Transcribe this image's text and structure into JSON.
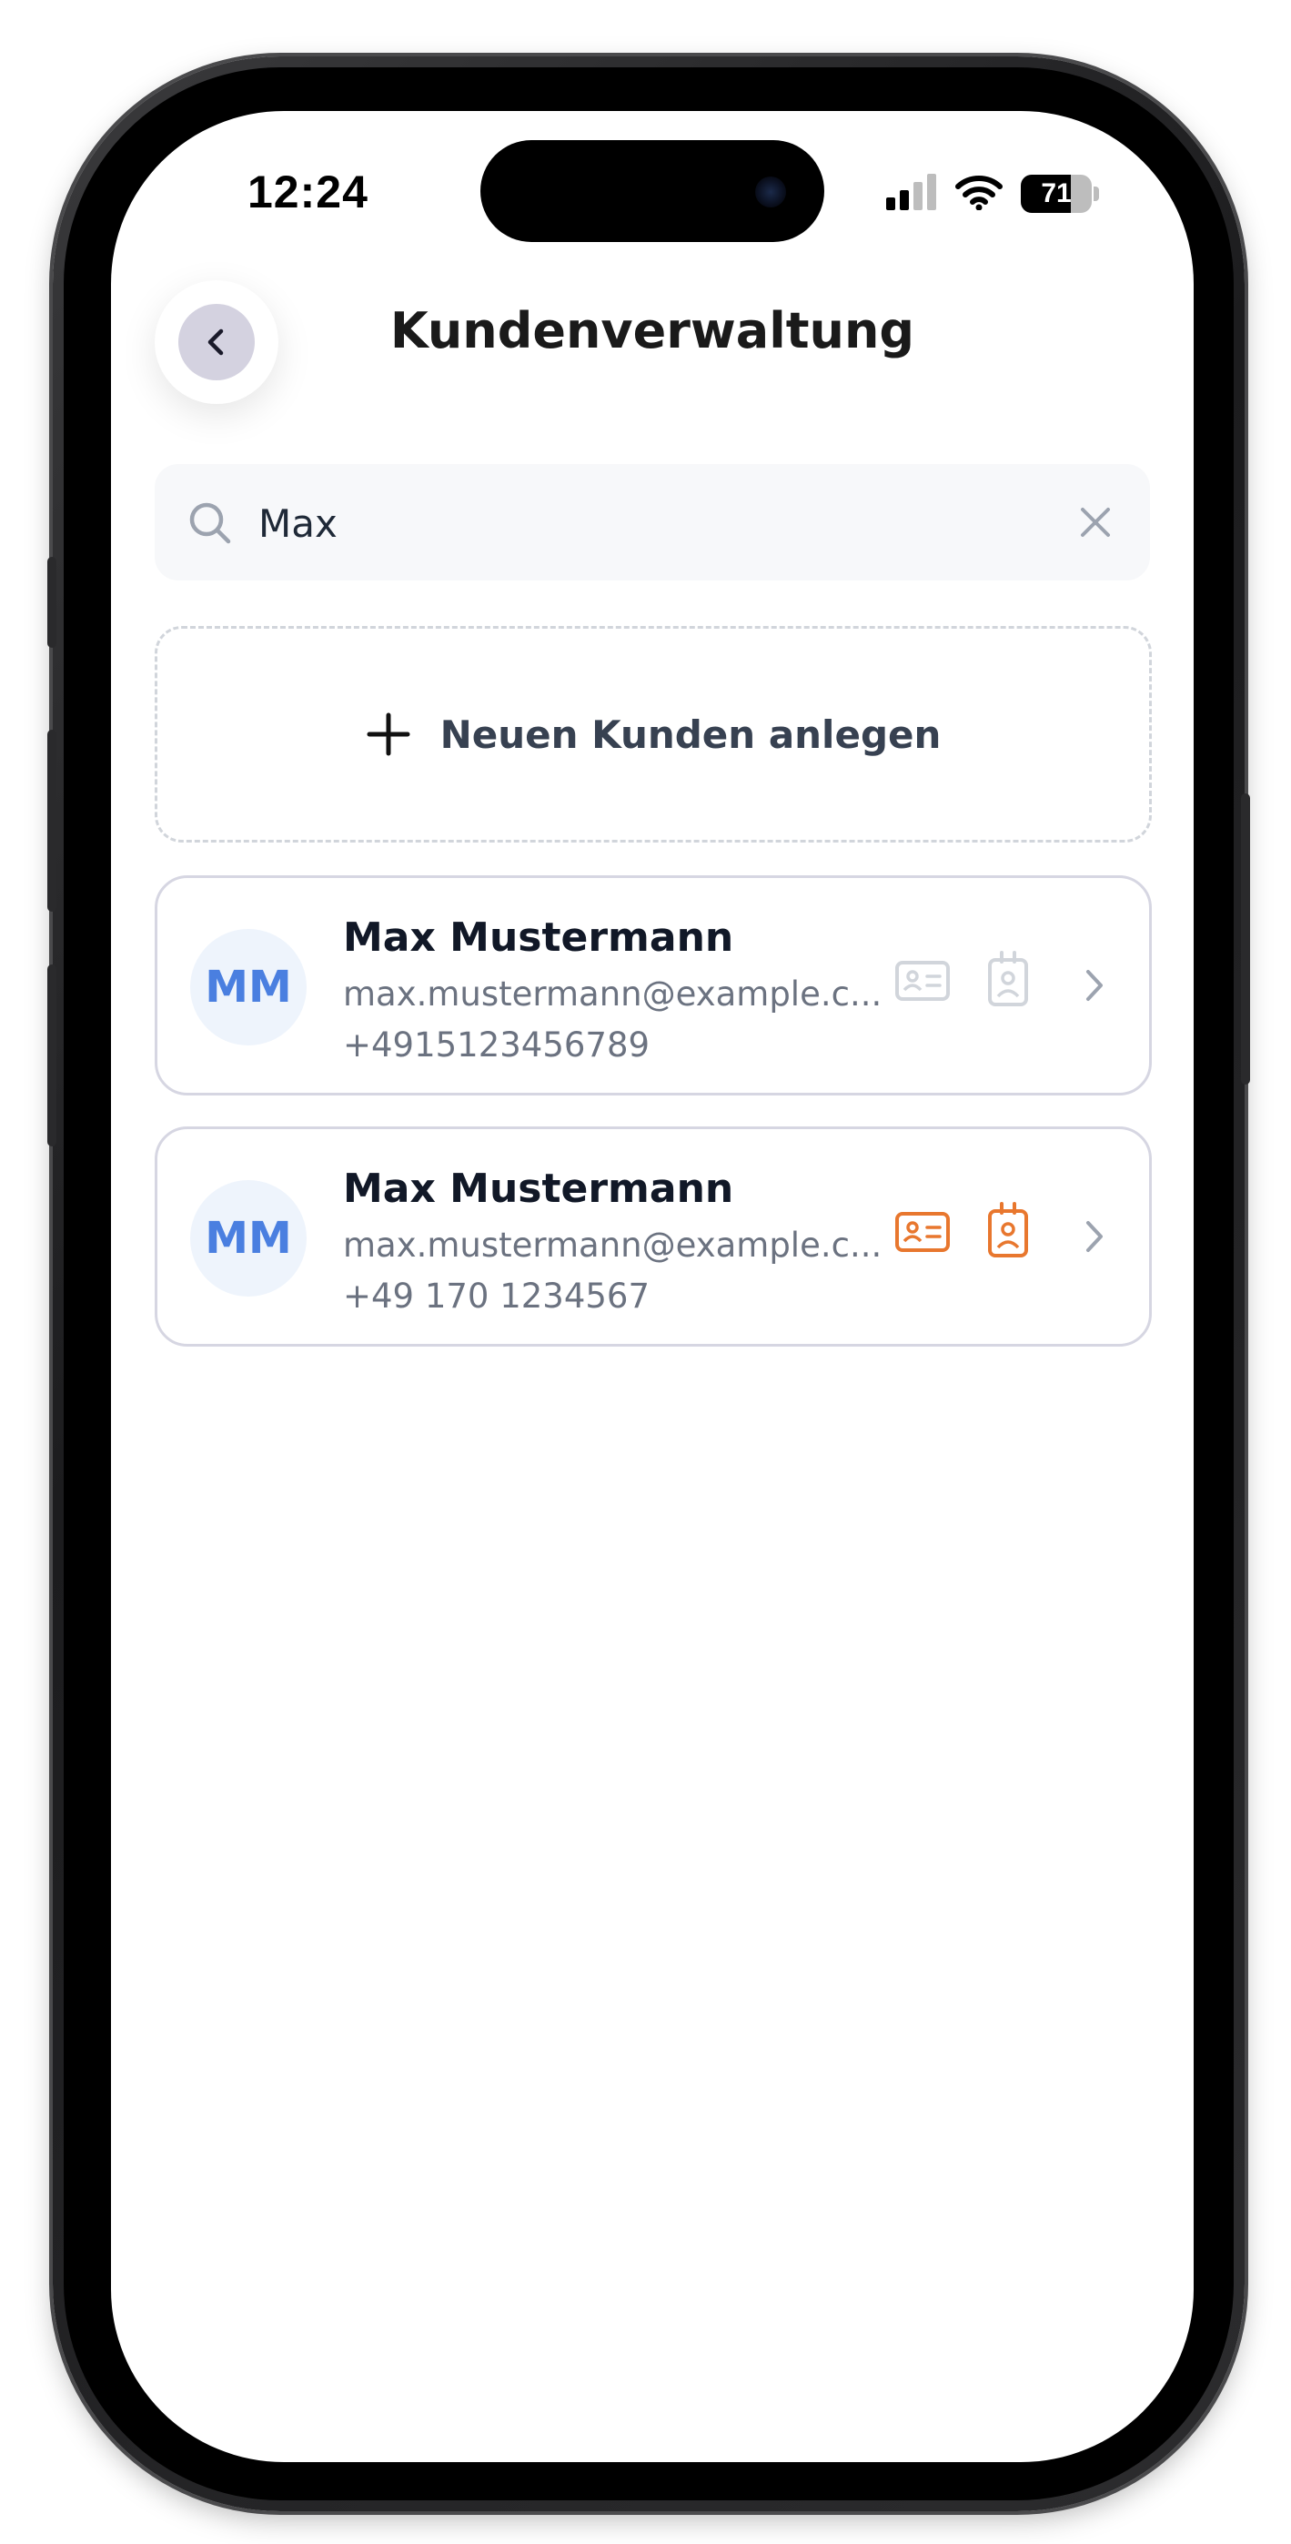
{
  "status_bar": {
    "time": "12:24",
    "battery": "71",
    "battery_level": 71
  },
  "header": {
    "title": "Kundenverwaltung",
    "back_icon": "chevron-left-icon"
  },
  "search": {
    "value": "Max",
    "placeholder": "",
    "search_icon": "search-icon",
    "clear_icon": "close-icon"
  },
  "add_customer": {
    "label": "Neuen Kunden anlegen",
    "icon": "plus-icon"
  },
  "customers": [
    {
      "initials": "MM",
      "name": "Max Mustermann",
      "email": "max.mustermann@example.c...",
      "phone": "+4915123456789",
      "id_card_icon": "id-card-icon",
      "badge_icon": "id-badge-icon",
      "status": "inactive",
      "icon_color": "#d1d5db"
    },
    {
      "initials": "MM",
      "name": "Max Mustermann",
      "email": "max.mustermann@example.c...",
      "phone": "+49 170 1234567",
      "id_card_icon": "id-card-icon",
      "badge_icon": "id-badge-icon",
      "status": "active",
      "icon_color": "#e8772e"
    }
  ],
  "colors": {
    "accent": "#4a7fe0",
    "avatar_bg": "#eef4fc",
    "active_icon": "#e8772e",
    "inactive_icon": "#d1d5db"
  }
}
